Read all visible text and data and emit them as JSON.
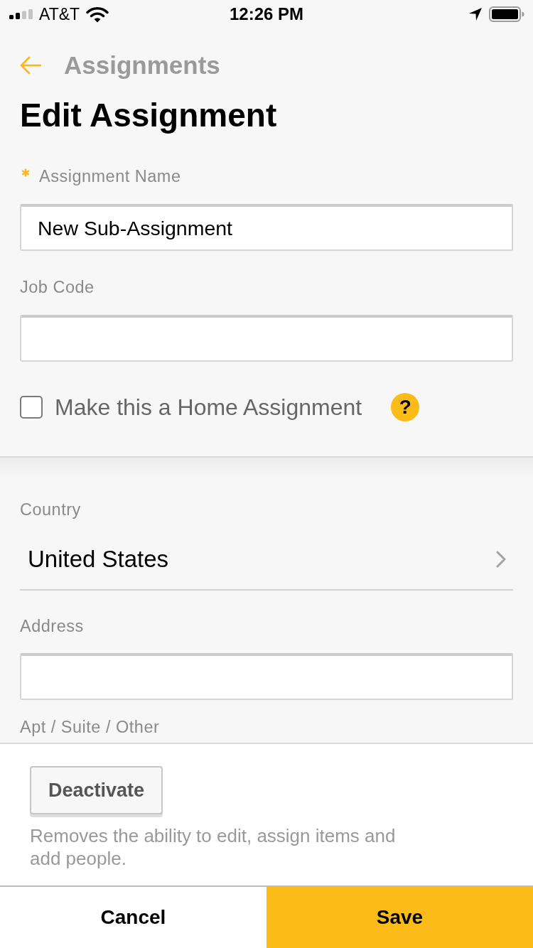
{
  "status_bar": {
    "carrier": "AT&T",
    "time": "12:26 PM"
  },
  "nav": {
    "back_label": "Assignments"
  },
  "title": "Edit Assignment",
  "sections": [
    {
      "fields": [
        {
          "kind": "text",
          "label": "Assignment Name",
          "required": true,
          "value": "New Sub-Assignment"
        },
        {
          "kind": "text",
          "label": "Job Code",
          "required": false
        },
        {
          "kind": "checkbox",
          "label": "Make this a Home Assignment",
          "checked": false,
          "help": "?"
        }
      ]
    },
    {
      "fields": [
        {
          "kind": "select",
          "label": "Country",
          "required": false,
          "value": "United States"
        },
        {
          "kind": "text",
          "label": "Address",
          "required": false
        },
        {
          "kind": "label",
          "label": "Apt / Suite / Other"
        }
      ]
    }
  ],
  "footer": {
    "button": "Deactivate",
    "description": "Removes the ability to edit, assign items and add people."
  },
  "actions": [
    {
      "kind": "secondary",
      "label": "Cancel"
    },
    {
      "kind": "primary",
      "label": "Save"
    }
  ]
}
